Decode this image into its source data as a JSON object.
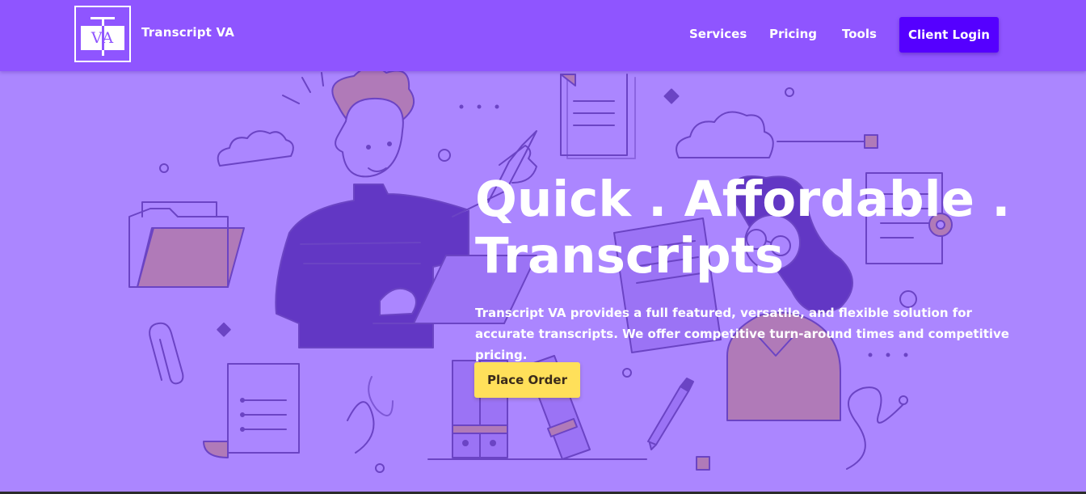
{
  "header": {
    "logo_text": "VA",
    "brand": "Transcript VA",
    "nav": [
      "Services",
      "Pricing",
      "Tools"
    ],
    "login_label": "Client Login"
  },
  "hero": {
    "title_line1": "Quick . Affordable .",
    "title_line2": "Transcripts",
    "subtitle": "Transcript VA provides a full featured, versatile, and flexible solution for accurate transcripts. We offer competitive turn-around times and competitive pricing.",
    "cta_label": "Place Order"
  },
  "colors": {
    "navbar": "#8f55ff",
    "hero_background": "#ab86ff",
    "login_button": "#5500ff",
    "cta_button": "#ffe05a",
    "illustration_line": "#6b44c4",
    "illustration_dark_fill": "#6237c4",
    "illustration_accent": "#b07ab8"
  },
  "icons": [
    "logo-icon",
    "cloud-icon",
    "folder-icon",
    "document-icon",
    "gear-icon",
    "paperclip-icon",
    "pencil-icon",
    "binder-icon",
    "laptop-icon"
  ]
}
